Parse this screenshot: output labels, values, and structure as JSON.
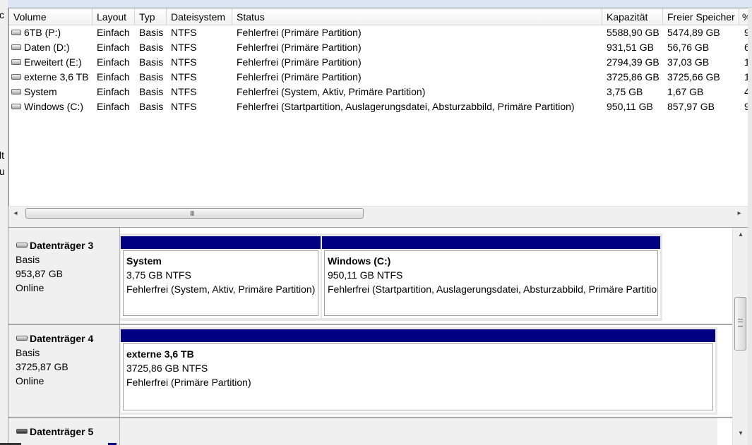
{
  "columns": [
    "Volume",
    "Layout",
    "Typ",
    "Dateisystem",
    "Status",
    "Kapazität",
    "Freier Speicher",
    "%"
  ],
  "volumes": [
    {
      "name": "6TB (P:)",
      "layout": "Einfach",
      "typ": "Basis",
      "fs": "NTFS",
      "status": "Fehlerfrei (Primäre Partition)",
      "capacity": "5588,90 GB",
      "free": "5474,89 GB",
      "pct": "9"
    },
    {
      "name": "Daten (D:)",
      "layout": "Einfach",
      "typ": "Basis",
      "fs": "NTFS",
      "status": "Fehlerfrei (Primäre Partition)",
      "capacity": "931,51 GB",
      "free": "56,76 GB",
      "pct": "6"
    },
    {
      "name": "Erweitert (E:)",
      "layout": "Einfach",
      "typ": "Basis",
      "fs": "NTFS",
      "status": "Fehlerfrei (Primäre Partition)",
      "capacity": "2794,39 GB",
      "free": "37,03 GB",
      "pct": "1"
    },
    {
      "name": "externe 3,6 TB",
      "layout": "Einfach",
      "typ": "Basis",
      "fs": "NTFS",
      "status": "Fehlerfrei (Primäre Partition)",
      "capacity": "3725,86 GB",
      "free": "3725,66 GB",
      "pct": "1"
    },
    {
      "name": "System",
      "layout": "Einfach",
      "typ": "Basis",
      "fs": "NTFS",
      "status": "Fehlerfrei (System, Aktiv, Primäre Partition)",
      "capacity": "3,75 GB",
      "free": "1,67 GB",
      "pct": "4"
    },
    {
      "name": "Windows (C:)",
      "layout": "Einfach",
      "typ": "Basis",
      "fs": "NTFS",
      "status": "Fehlerfrei (Startpartition, Auslagerungsdatei, Absturzabbild, Primäre Partition)",
      "capacity": "950,11 GB",
      "free": "857,97 GB",
      "pct": "9"
    }
  ],
  "hscroll_grip": "III",
  "disks": [
    {
      "name": "Datenträger 3",
      "type": "Basis",
      "size": "953,87 GB",
      "state": "Online",
      "partitions": [
        {
          "title": "System",
          "size": "3,75 GB NTFS",
          "status": "Fehlerfrei (System, Aktiv, Primäre Partition)"
        },
        {
          "title": "Windows  (C:)",
          "size": "950,11 GB NTFS",
          "status": "Fehlerfrei (Startpartition, Auslagerungsdatei, Absturzabbild, Primäre Partition)"
        }
      ]
    },
    {
      "name": "Datenträger 4",
      "type": "Basis",
      "size": "3725,87 GB",
      "state": "Online",
      "partitions": [
        {
          "title": "externe 3,6 TB",
          "size": "3725,86 GB NTFS",
          "status": "Fehlerfrei (Primäre Partition)"
        }
      ]
    },
    {
      "name": "Datenträger 5"
    }
  ],
  "left_strip_glyphs": [
    "c",
    "lt",
    "u"
  ],
  "icons": {
    "volume": "drive-icon",
    "disk": "disk-icon",
    "scroll_left": "◂",
    "scroll_right": "▸",
    "scroll_up": "▴",
    "scroll_down": "▾"
  },
  "colors": {
    "partition_bar": "#000080",
    "background": "#f0f0f0"
  }
}
